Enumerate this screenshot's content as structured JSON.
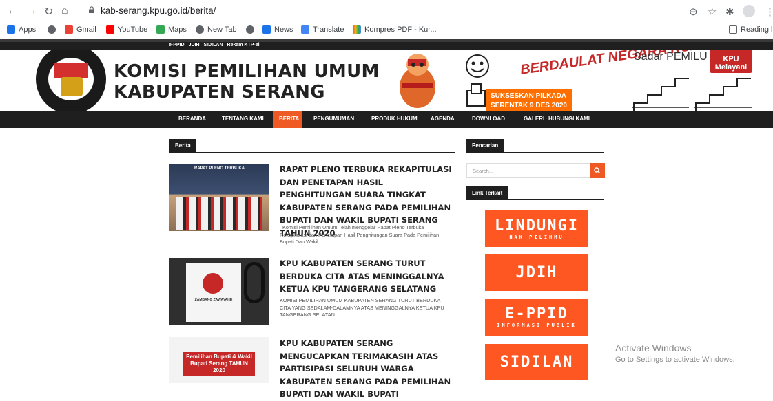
{
  "browser": {
    "url": "kab-serang.kpu.go.id/berita/",
    "bookmarks": [
      {
        "label": "Apps",
        "icon": "apps-grid-icon",
        "color": "#1a73e8"
      },
      {
        "label": "",
        "icon": "globe-icon",
        "color": "#5f6368"
      },
      {
        "label": "Gmail",
        "icon": "google-icon",
        "color": "#ea4335"
      },
      {
        "label": "YouTube",
        "icon": "youtube-icon",
        "color": "#ff0000"
      },
      {
        "label": "Maps",
        "icon": "maps-icon",
        "color": "#34a853"
      },
      {
        "label": "New Tab",
        "icon": "globe-icon",
        "color": "#5f6368"
      },
      {
        "label": "",
        "icon": "globe-icon",
        "color": "#5f6368"
      },
      {
        "label": "News",
        "icon": "news-icon",
        "color": "#1a73e8"
      },
      {
        "label": "Translate",
        "icon": "translate-icon",
        "color": "#4285f4"
      },
      {
        "label": "Kompres PDF - Kur...",
        "icon": "pdf-icon",
        "color": "#fbbc04"
      }
    ],
    "reading_list": "Reading lis"
  },
  "site": {
    "top_links": [
      "e-PPID",
      "JDIH",
      "SIDILAN",
      "Rekam KTP-el"
    ],
    "title_line1": "KOMISI PEMILIHAN UMUM",
    "title_line2": "KABUPATEN SERANG",
    "logo_text": "KOMISI",
    "banner_berdaulat": "BERDAULAT NEGARA KUAT",
    "banner_sukseskan": "SUKSESKAN PILKADA SERENTAK 9 DES 2020",
    "banner_sadar": "Sadar PEMILU",
    "banner_kpu": "KPU Melayani",
    "nav": [
      "BERANDA",
      "TENTANG KAMI",
      "BERITA",
      "PENGUMUMAN",
      "PRODUK HUKUM",
      "AGENDA",
      "DOWNLOAD",
      "GALERI",
      "HUBUNGI KAMI"
    ],
    "nav_active": "BERITA",
    "accent": "#ef5a24"
  },
  "content": {
    "section_title": "Berita",
    "posts": [
      {
        "title": "RAPAT PLENO TERBUKA REKAPITULASI DAN PENETAPAN HASIL PENGHITUNGAN SUARA TINGKAT KABUPATEN SERANG PADA PEMILIHAN BUPATI DAN WAKIL BUPATI SERANG TAHUN 2020",
        "excerpt": "Komisi Pemilihan Umum Telah menggelar Rapat Pleno Terbuka Rekapitulasi dan Penetapan Hasil Penghitungan Suara Pada Pemilihan Bupati Dan Wakil...",
        "thumb_caption": "RAPAT PLENO TERBUKA"
      },
      {
        "title": "KPU KABUPATEN SERANG TURUT BERDUKA CITA ATAS MENINGGALNYA KETUA KPU TANGERANG SELATANG",
        "excerpt": "KOMISI PEMILIHAN UMUM KABUPATEN SERANG TURUT BERDUKA CITA YANG SEDALAM-DALAMNYA ATAS MENINGGALNYA KETUA KPU TANGERANG SELATAN",
        "thumb_caption": "ZAMBANG ZAWAYAHD"
      },
      {
        "title": "KPU KABUPATEN SERANG MENGUCAPKAN TERIMAKASIH ATAS PARTISIPASI SELURUH WARGA KABUPATEN SERANG PADA PEMILIHAN BUPATI DAN WAKIL BUPATI",
        "excerpt": "",
        "thumb_caption": "Pemilihan Bupati & Wakil Bupati Serang TAHUN 2020"
      }
    ]
  },
  "sidebar": {
    "search_title": "Pencarian",
    "search_placeholder": "Search...",
    "links_title": "Link Terkait",
    "promos": [
      {
        "main": "LINDUNGI",
        "sub": "HAK PILIHMU"
      },
      {
        "main": "JDIH",
        "sub": ""
      },
      {
        "main": "E-PPID",
        "sub": "INFORMASI PUBLIK"
      },
      {
        "main": "SIDILAN",
        "sub": ""
      }
    ]
  },
  "watermark": {
    "title": "Activate Windows",
    "subtitle": "Go to Settings to activate Windows."
  }
}
